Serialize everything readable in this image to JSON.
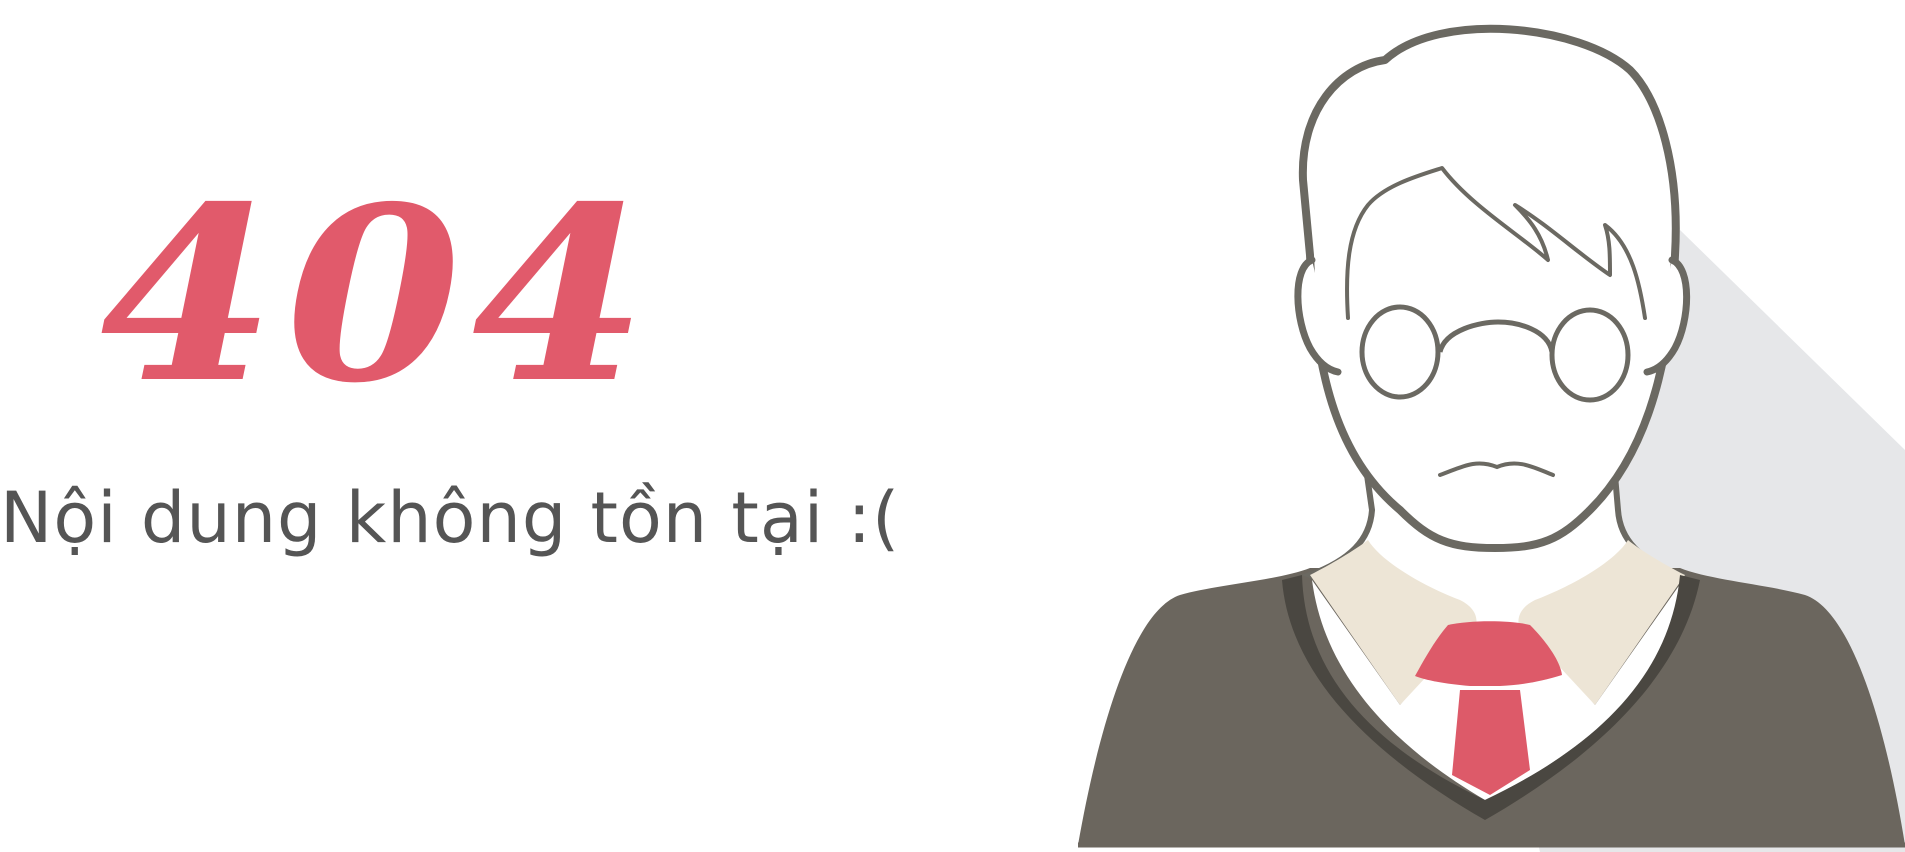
{
  "error": {
    "code": "404",
    "message": "Nội dung không tồn tại :("
  },
  "illustration": {
    "icon": "man-with-glasses-illustration"
  },
  "colors": {
    "accent": "#e15a6b",
    "text": "#555555",
    "outline": "#6b6962",
    "sweater": "#6b665e",
    "collar": "#ede5d6",
    "tie": "#dd5a69",
    "shadow": "#e6e7e9"
  }
}
